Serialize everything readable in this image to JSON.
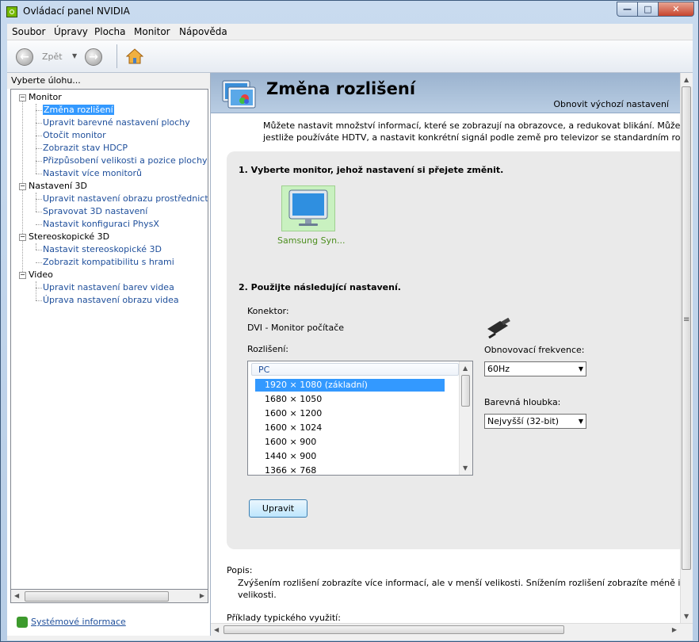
{
  "window": {
    "title": "Ovládací panel NVIDIA",
    "minimize_glyph": "—",
    "maximize_glyph": "□",
    "close_glyph": "✕"
  },
  "menu": [
    "Soubor",
    "Úpravy",
    "Plocha",
    "Monitor",
    "Nápověda"
  ],
  "toolbar": {
    "back_label": "Zpět",
    "back_glyph": "←",
    "forward_glyph": "→",
    "dropdown_glyph": "▼"
  },
  "left": {
    "header": "Vyberte úlohu...",
    "tree": [
      {
        "label": "Monitor",
        "children": [
          "Změna rozlišení",
          "Upravit barevné nastavení plochy",
          "Otočit monitor",
          "Zobrazit stav HDCP",
          "Přizpůsobení velikosti a pozice plochy",
          "Nastavit více monitorů"
        ]
      },
      {
        "label": "Nastavení 3D",
        "children": [
          "Upravit nastavení obrazu prostřednictvím náhledu",
          "Spravovat 3D nastavení",
          "Nastavit konfiguraci PhysX"
        ]
      },
      {
        "label": "Stereoskopické 3D",
        "children": [
          "Nastavit stereoskopické 3D",
          "Zobrazit kompatibilitu s hrami"
        ]
      },
      {
        "label": "Video",
        "children": [
          "Upravit nastavení barev videa",
          "Úprava nastavení obrazu videa"
        ]
      }
    ],
    "selected_item": "Změna rozlišení",
    "expand_glyph": "−",
    "scroll_left": "◀",
    "scroll_right": "▶",
    "system_info": "Systémové informace"
  },
  "content": {
    "title": "Změna rozlišení",
    "restore_defaults": "Obnovit výchozí nastavení",
    "intro": [
      "Můžete nastavit množství informací, které se zobrazují na obrazovce, a redukovat blikání. Můžete také vybrat t",
      "jestliže používáte HDTV, a nastavit konkrétní signál podle země pro televizor se standardním rozlišením (SD)."
    ],
    "step1": "1. Vyberte monitor, jehož nastavení si přejete změnit.",
    "monitor_name": "Samsung Syn...",
    "step2": "2. Použijte následující nastavení.",
    "connector_label": "Konektor:",
    "connector_value": "DVI - Monitor počítače",
    "resolution_label": "Rozlišení:",
    "resolution_group": "PC",
    "resolutions": [
      "1920 × 1080 (základní)",
      "1680 × 1050",
      "1600 × 1200",
      "1600 × 1024",
      "1600 × 900",
      "1440 × 900",
      "1366 × 768"
    ],
    "selected_resolution": "1920 × 1080 (základní)",
    "refresh_label": "Obnovovací frekvence:",
    "refresh_value": "60Hz",
    "depth_label": "Barevná hloubka:",
    "depth_value": "Nejvyšší (32-bit)",
    "apply_button": "Upravit",
    "description_title": "Popis:",
    "description": [
      "Zvýšením rozlišení zobrazíte více informací, ale v menší velikosti. Snížením rozlišení zobrazíte méně informací, ale ve v",
      "velikosti."
    ],
    "examples_title": "Příklady typického využití:",
    "scroll_up": "▲",
    "scroll_down": "▼",
    "scroll_left": "◀",
    "scroll_right": "▶",
    "scroll_grip": "≡"
  },
  "colors": {
    "accent": "#3399ff",
    "link": "#1f4f9b",
    "nvidia_green": "#76b900",
    "monitor_label": "#4c8e1e"
  }
}
